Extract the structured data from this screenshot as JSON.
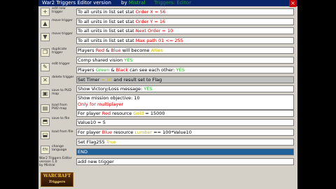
{
  "title": {
    "app": "War2 Triggers Editor version",
    "by": "by",
    "author": "Mistral",
    "ghost": "Triggers: Editor"
  },
  "close_glyph": "×",
  "sidebar": [
    {
      "label": "add new\ntrigger",
      "icon": "add-trigger-icon",
      "glyph": "+"
    },
    {
      "label": "move trigger",
      "icon": "move-up-icon",
      "glyph": "▲"
    },
    {
      "label": "move trigger",
      "icon": "move-down-icon",
      "glyph": "▼"
    },
    {
      "label": "duplicate\ntrigger",
      "icon": "duplicate-icon",
      "glyph": "❐"
    },
    {
      "label": "edit trigger",
      "icon": "edit-icon",
      "glyph": "✎"
    },
    {
      "label": "delete trigger",
      "icon": "delete-icon",
      "glyph": "✕"
    },
    {
      "label": "save to PUD\nmap",
      "icon": "save-pud-icon",
      "glyph": "▣"
    },
    {
      "label": "load from\nPUD map",
      "icon": "load-pud-icon",
      "glyph": "▤"
    },
    {
      "label": "save to file",
      "icon": "save-file-icon",
      "glyph": "⬒"
    },
    {
      "label": "load from file",
      "icon": "load-file-icon",
      "glyph": "⬓"
    },
    {
      "label": "change\nlanguage",
      "icon": "language-icon",
      "glyph": "EN"
    }
  ],
  "version_info": {
    "line1": "War2 Triggers Editor",
    "line2": "version 1.0",
    "line3": "by Mistral"
  },
  "logo": {
    "top": "WARCRAFT",
    "bottom": "Triggers"
  },
  "triggers": [
    {
      "parts": [
        "To all units in list set stat ",
        "Order X",
        " = 56"
      ]
    },
    {
      "parts": [
        "To all units in list set stat ",
        "Order Y",
        " = 16"
      ]
    },
    {
      "parts": [
        "To all units in list set stat ",
        "Next Order",
        " = 10"
      ]
    },
    {
      "parts": [
        "To all units in list set stat ",
        "Max path 01",
        " <= 255"
      ]
    },
    {
      "parts": [
        "Players ",
        "Red",
        " & ",
        "Blue",
        " will become ",
        "Allies"
      ]
    },
    {
      "parts": [
        "Comp shared vision ",
        "YES"
      ]
    },
    {
      "parts": [
        "Players ",
        "Green",
        " & ",
        "Black",
        " can see each other: ",
        "YES"
      ]
    },
    {
      "parts": [
        "Set Timer ",
        "= 10",
        " and result set to Flag"
      ]
    },
    {
      "parts": [
        "Show Victory/Loss message: ",
        "YES"
      ]
    },
    {
      "parts": [
        "Show mission objective: 10",
        "Only for multiplayer"
      ]
    },
    {
      "parts": [
        "For player ",
        "Red",
        " resource ",
        "Gold",
        " = 15000"
      ]
    },
    {
      "parts": [
        "Value10 = 5"
      ]
    },
    {
      "parts": [
        "For player ",
        "Blue",
        " resource ",
        "Lumber",
        " == 100*Value10"
      ]
    },
    {
      "parts": [
        "Set Flag255 ",
        "True"
      ]
    },
    {
      "parts": [
        "END"
      ]
    },
    {
      "parts": [
        "add new trigger"
      ]
    }
  ]
}
